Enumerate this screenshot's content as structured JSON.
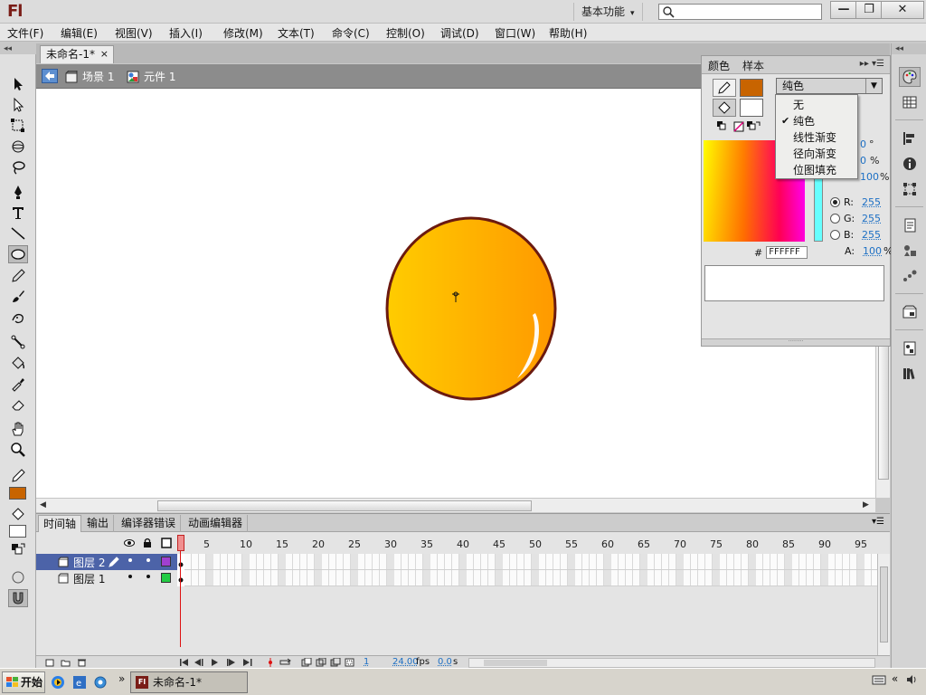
{
  "app": {
    "logo": "Fl",
    "workspace": "基本功能",
    "search": {
      "value": "",
      "placeholder": ""
    },
    "window_buttons": {
      "minimize": "—",
      "restore": "❐",
      "close": "✕"
    }
  },
  "menu": [
    "文件(F)",
    "编辑(E)",
    "视图(V)",
    "插入(I)",
    "修改(M)",
    "文本(T)",
    "命令(C)",
    "控制(O)",
    "调试(D)",
    "窗口(W)",
    "帮助(H)"
  ],
  "document_tab": {
    "title": "未命名-1*",
    "close": "×"
  },
  "breadcrumb": {
    "scene": "场景 1",
    "symbol": "元件 1"
  },
  "tools": {
    "names": [
      "selection",
      "subselection",
      "free-transform",
      "3d-rotation",
      "lasso",
      "pen",
      "text",
      "line",
      "oval",
      "pencil",
      "brush",
      "deco",
      "bone",
      "paint-bucket",
      "eyedropper",
      "eraser",
      "hand",
      "zoom"
    ],
    "stroke_color": "#c86400",
    "fill_color": "#ffffff"
  },
  "stage": {
    "ball_gradient_start": "#ffcc00",
    "ball_gradient_end": "#ff9900",
    "ball_stroke": "#6b1a10"
  },
  "color_panel": {
    "tabs": [
      "颜色",
      "样本"
    ],
    "stroke_color": "#c86400",
    "fill_color": "#ffffff",
    "fill_type": "纯色",
    "hsb_partial": {
      "h": "0",
      "s": "0",
      "b": "100"
    },
    "units": {
      "degree": "°",
      "percent": "%"
    },
    "rgb": {
      "r_label": "R:",
      "r": "255",
      "g_label": "G:",
      "g": "255",
      "b_label": "B:",
      "b": "255"
    },
    "alpha_label": "A:",
    "alpha": "100",
    "hex_label": "#",
    "hex": "FFFFFF"
  },
  "fill_type_dropdown": {
    "items": [
      {
        "label": "无",
        "checked": false
      },
      {
        "label": "纯色",
        "checked": true
      },
      {
        "label": "线性渐变",
        "checked": false
      },
      {
        "label": "径向渐变",
        "checked": false
      },
      {
        "label": "位图填充",
        "checked": false
      }
    ],
    "check_mark": "✔"
  },
  "timeline": {
    "tabs": [
      "时间轴",
      "输出",
      "编译器错误",
      "动画编辑器"
    ],
    "frame_numbers": [
      "1",
      "5",
      "10",
      "15",
      "20",
      "25",
      "30",
      "35",
      "40",
      "45",
      "50",
      "55",
      "60",
      "65",
      "70",
      "75",
      "80",
      "85",
      "90",
      "95"
    ],
    "layers": [
      {
        "name": "图层 2",
        "active": true,
        "color": "#a040d0"
      },
      {
        "name": "图层 1",
        "active": false,
        "color": "#22cc44"
      }
    ],
    "footer": {
      "current_frame": "1",
      "fps": "24.00",
      "fps_unit": "fps",
      "time": "0.0",
      "time_unit": "s"
    }
  },
  "taskbar": {
    "start": "开始",
    "chevron": "»",
    "task_title": "未命名-1*",
    "tray_chevron": "«"
  }
}
